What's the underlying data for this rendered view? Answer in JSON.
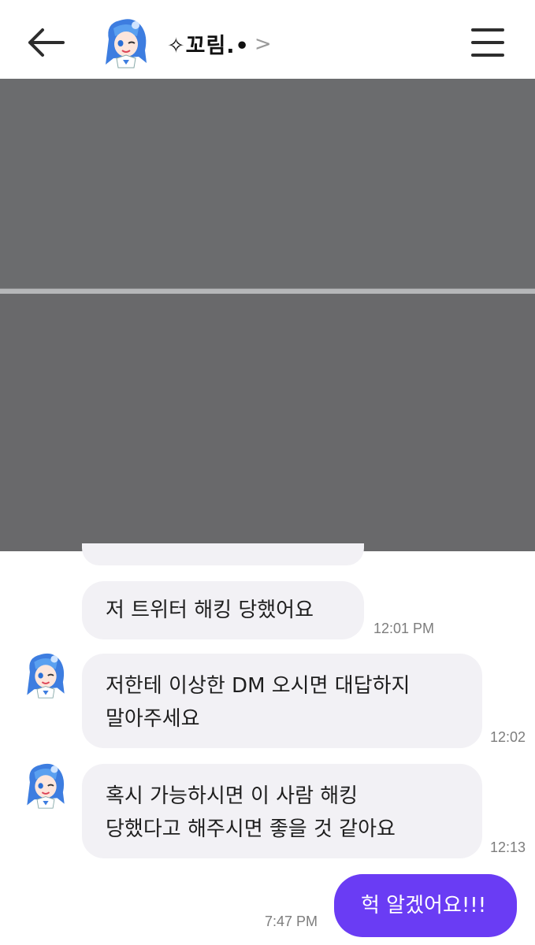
{
  "header": {
    "title": "✧꼬림.•",
    "chevron": ">"
  },
  "messages": [
    {
      "text": "저 트위터 해킹 당했어요",
      "time": "12:01 PM"
    },
    {
      "line1": "저한테 이상한 DM 오시면 대답하지",
      "line2": "말아주세요",
      "time": "12:02"
    },
    {
      "line1": "혹시 가능하시면 이 사람 해킹",
      "line2": "당했다고 해주시면 좋을 것 같아요",
      "time": "12:13"
    }
  ],
  "my_message": {
    "text": "헉 알겠어요!!!",
    "time": "7:47 PM"
  },
  "colors": {
    "accent": "#6a3cf4",
    "incoming_bubble": "#f2f1f5",
    "redaction": "#6b6c6e"
  }
}
